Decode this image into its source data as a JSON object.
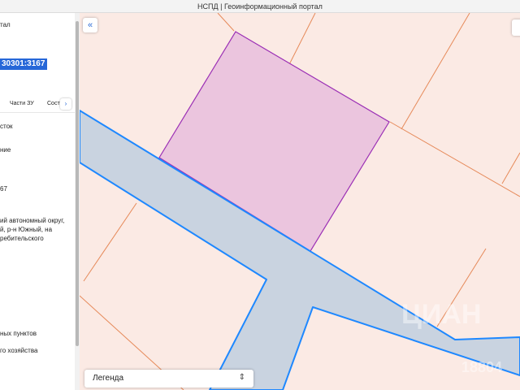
{
  "window": {
    "title": "НСПД | Геоинформационный портал"
  },
  "panel": {
    "header_fragment": "тал",
    "cadastral_number_fragment": "30301:3167",
    "tabs": [
      {
        "label": "Части ЗУ"
      },
      {
        "label": "Сост"
      }
    ],
    "tab_next_glyph": "›",
    "fields": [
      {
        "text": "сток"
      },
      {
        "text": "ние"
      },
      {
        "text": "67"
      },
      {
        "text": "ий автономный округ,"
      },
      {
        "text": "й, р-н Южный, на"
      },
      {
        "text": "ребительского"
      },
      {
        "text": "ных пунктов"
      },
      {
        "text": "го хозяйства"
      }
    ]
  },
  "map": {
    "collapse_glyph": "«",
    "legend_label": "Легенда",
    "legend_chevron": "⌃⌄",
    "watermark": "ЦИАН",
    "watermark_id": "18804"
  },
  "colors": {
    "background": "#fbeae4",
    "parcel_fill": "#ebc5de",
    "parcel_stroke": "#9b2fb5",
    "road_fill": "#c9d3e0",
    "road_stroke": "#1e88ff",
    "boundary_line": "#e68a5a",
    "highlight": "#2667d8"
  },
  "icons": {
    "collapse": "double-chevron-left-icon",
    "tab_next": "chevron-right-icon",
    "legend_toggle": "chevron-up-down-icon"
  }
}
